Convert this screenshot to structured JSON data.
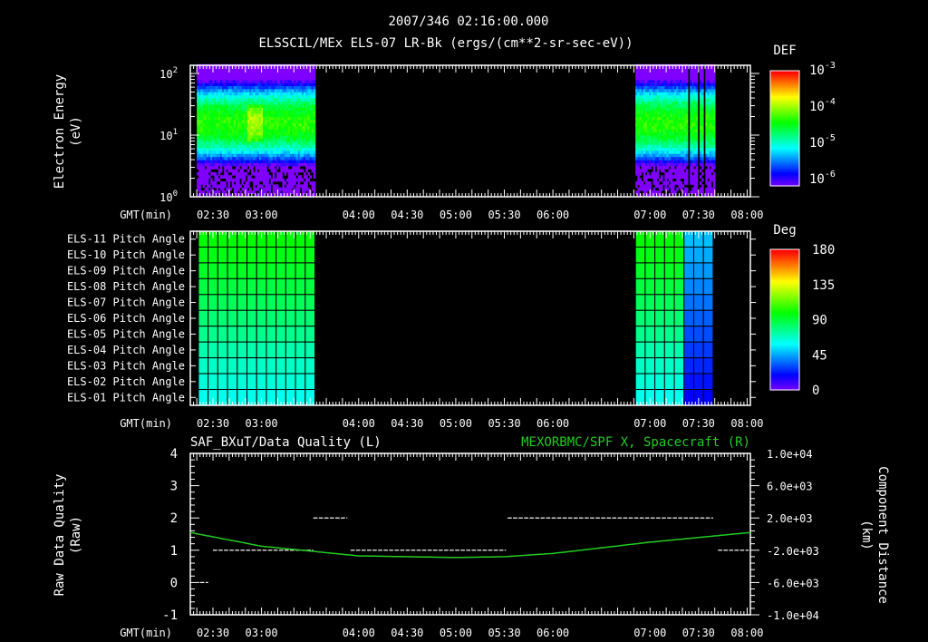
{
  "title": "2007/346 02:16:00.000",
  "chart_data": [
    {
      "type": "heatmap",
      "title": "ELSSCIL/MEx ELS-07 LR-Bk  (ergs/(cm**2-sr-sec-eV))",
      "ylabel": "Electron Energy",
      "yunit": "(eV)",
      "xlabel": "GMT(min)",
      "x_range_min": [
        136,
        482
      ],
      "ylim": [
        1,
        135
      ],
      "yticks": [
        {
          "v": 1,
          "label": "10",
          "exp": "0"
        },
        {
          "v": 10,
          "label": "10",
          "exp": "1"
        },
        {
          "v": 100,
          "label": "10",
          "exp": "2"
        }
      ],
      "xticks": [
        "02:30",
        "03:00",
        "04:00",
        "04:30",
        "05:00",
        "05:30",
        "06:00",
        "07:00",
        "07:30",
        "08:00"
      ],
      "xtick_minutes": [
        150,
        180,
        240,
        270,
        300,
        330,
        360,
        420,
        450,
        480
      ],
      "data_intervals_min": [
        [
          140,
          213
        ],
        [
          411,
          459
        ]
      ],
      "peak_energy_eV": 15,
      "colorbar": {
        "label": "DEF",
        "ticks": [
          {
            "base": "10",
            "exp": "-3"
          },
          {
            "base": "10",
            "exp": "-4"
          },
          {
            "base": "10",
            "exp": "-5"
          },
          {
            "base": "10",
            "exp": "-6"
          }
        ],
        "log_range": [
          -6,
          -3
        ]
      }
    },
    {
      "type": "heatmap",
      "xlabel": "GMT(min)",
      "rows": [
        "ELS-11 Pitch Angle",
        "ELS-10 Pitch Angle",
        "ELS-09 Pitch Angle",
        "ELS-08 Pitch Angle",
        "ELS-07 Pitch Angle",
        "ELS-06 Pitch Angle",
        "ELS-05 Pitch Angle",
        "ELS-04 Pitch Angle",
        "ELS-03 Pitch Angle",
        "ELS-02 Pitch Angle",
        "ELS-01 Pitch Angle"
      ],
      "row_values_deg": [
        100,
        97,
        94,
        90,
        86,
        82,
        78,
        73,
        69,
        66,
        63
      ],
      "data_intervals_min": [
        [
          141,
          213
        ],
        [
          411,
          459
        ]
      ],
      "colorbar": {
        "label": "Deg",
        "ticks": [
          "180",
          "135",
          "90",
          "45",
          "0"
        ],
        "range": [
          0,
          180
        ]
      }
    },
    {
      "type": "line",
      "title_left": "SAF_BXuT/Data Quality (L)",
      "title_right": "MEXORBMC/SPF X, Spacecraft (R)",
      "ylabel_left": "Raw Data Quality",
      "yunit_left": "(Raw)",
      "ylabel_right": "Component Distance",
      "yunit_right": "(km)",
      "xlabel": "GMT(min)",
      "ylim_left": [
        -1,
        4
      ],
      "ylim_right": [
        -10000,
        10000
      ],
      "yticks_left": [
        "4",
        "3",
        "2",
        "1",
        "0",
        "-1"
      ],
      "yticks_right": [
        "1.0e+04",
        "6.0e+03",
        "2.0e+03",
        "-2.0e+03",
        "-6.0e+03",
        "-1.0e+04"
      ],
      "quality_segments": [
        {
          "from": 142,
          "to": 147,
          "value": 0
        },
        {
          "from": 150,
          "to": 212,
          "value": 1
        },
        {
          "from": 212,
          "to": 233,
          "value": 2
        },
        {
          "from": 235,
          "to": 331,
          "value": 1
        },
        {
          "from": 332,
          "to": 459,
          "value": 2
        },
        {
          "from": 462,
          "to": 481,
          "value": 1
        }
      ],
      "spacecraft_x_km": {
        "minutes": [
          136,
          180,
          240,
          300,
          330,
          360,
          420,
          482
        ],
        "values": [
          200,
          -1500,
          -2700,
          -2900,
          -2800,
          -2400,
          -1000,
          200
        ]
      },
      "line_color": "#22cc22"
    }
  ]
}
